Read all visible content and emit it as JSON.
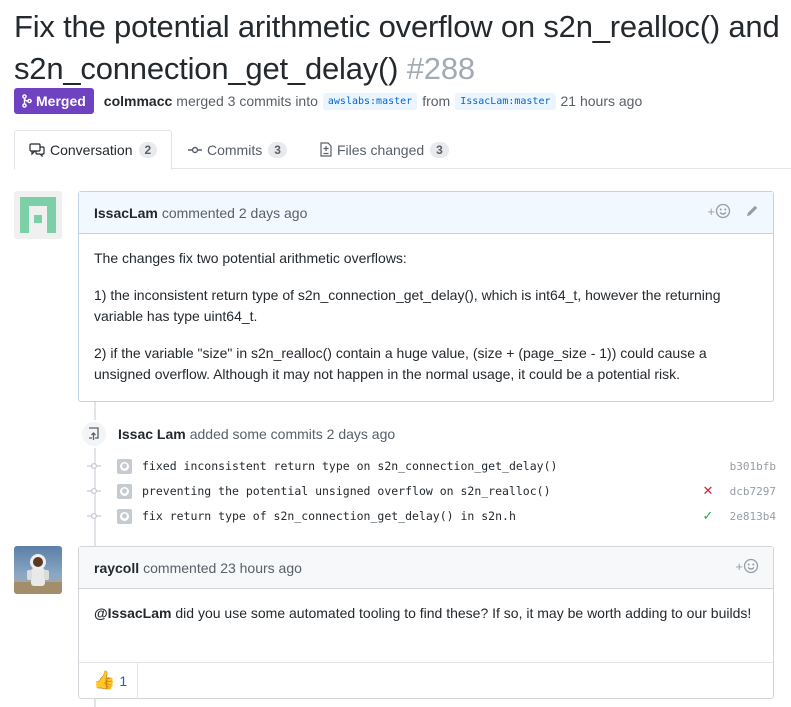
{
  "pr": {
    "title": "Fix the potential arithmetic overflow on s2n_realloc() and s2n_connection_get_delay()",
    "number": "#288",
    "state": "Merged",
    "merged_by": "colmmacc",
    "merge_text": "merged 3 commits into",
    "base_branch": "awslabs:master",
    "from_text": "from",
    "head_branch": "IssacLam:master",
    "time": "21 hours ago"
  },
  "tabs": [
    {
      "label": "Conversation",
      "count": "2",
      "icon": "comment-discussion-icon"
    },
    {
      "label": "Commits",
      "count": "3",
      "icon": "git-commit-icon"
    },
    {
      "label": "Files changed",
      "count": "3",
      "icon": "file-diff-icon"
    }
  ],
  "comment1": {
    "author": "IssacLam",
    "action": "commented",
    "time": "2 days ago",
    "body": [
      "The changes fix two potential arithmetic overflows:",
      "1) the inconsistent return type of s2n_connection_get_delay(), which is int64_t, however the returning variable has type uint64_t.",
      "2) if the variable \"size\" in s2n_realloc() contain a huge value, (size + (page_size - 1)) could cause a unsigned overflow. Although it may not happen in the normal usage, it could be a potential risk."
    ]
  },
  "event": {
    "author": "Issac Lam",
    "text": "added some commits",
    "time": "2 days ago"
  },
  "commits": [
    {
      "message": "fixed inconsistent return type on s2n_connection_get_delay()",
      "sha": "b301bfb",
      "status": "none"
    },
    {
      "message": "preventing the potential unsigned overflow on s2n_realloc()",
      "sha": "dcb7297",
      "status": "fail"
    },
    {
      "message": "fix return type of s2n_connection_get_delay() in s2n.h",
      "sha": "2e813b4",
      "status": "success"
    }
  ],
  "comment2": {
    "author": "raycoll",
    "action": "commented",
    "time": "23 hours ago",
    "mention": "@IssacLam",
    "body": "did you use some automated tooling to find these? If so, it may be worth adding to our builds!",
    "reaction_count": "1",
    "reaction_icon": "thumbs-up-icon"
  },
  "colors": {
    "merged": "#6f42c1",
    "link": "#0366d6",
    "fail": "#cb2431",
    "success": "#28a745"
  }
}
